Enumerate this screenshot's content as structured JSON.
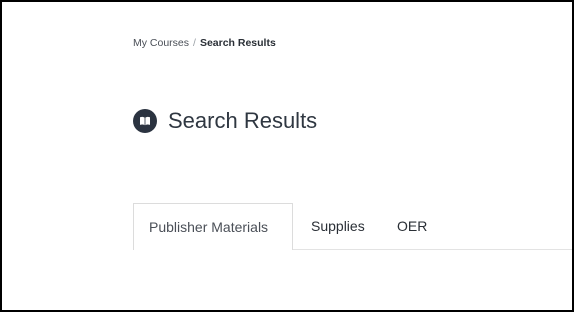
{
  "breadcrumb": {
    "items": [
      {
        "label": "My Courses"
      },
      {
        "label": "Search Results"
      }
    ],
    "separator": "/"
  },
  "page": {
    "title": "Search Results",
    "title_icon": "book-icon"
  },
  "tabs": [
    {
      "label": "Publisher Materials",
      "active": true
    },
    {
      "label": "Supplies",
      "active": false
    },
    {
      "label": "OER",
      "active": false
    }
  ],
  "colors": {
    "text_dark": "#2f3741",
    "icon_bg": "#2b3340",
    "tab_border": "#dcdcdc",
    "page_border": "#000000"
  }
}
